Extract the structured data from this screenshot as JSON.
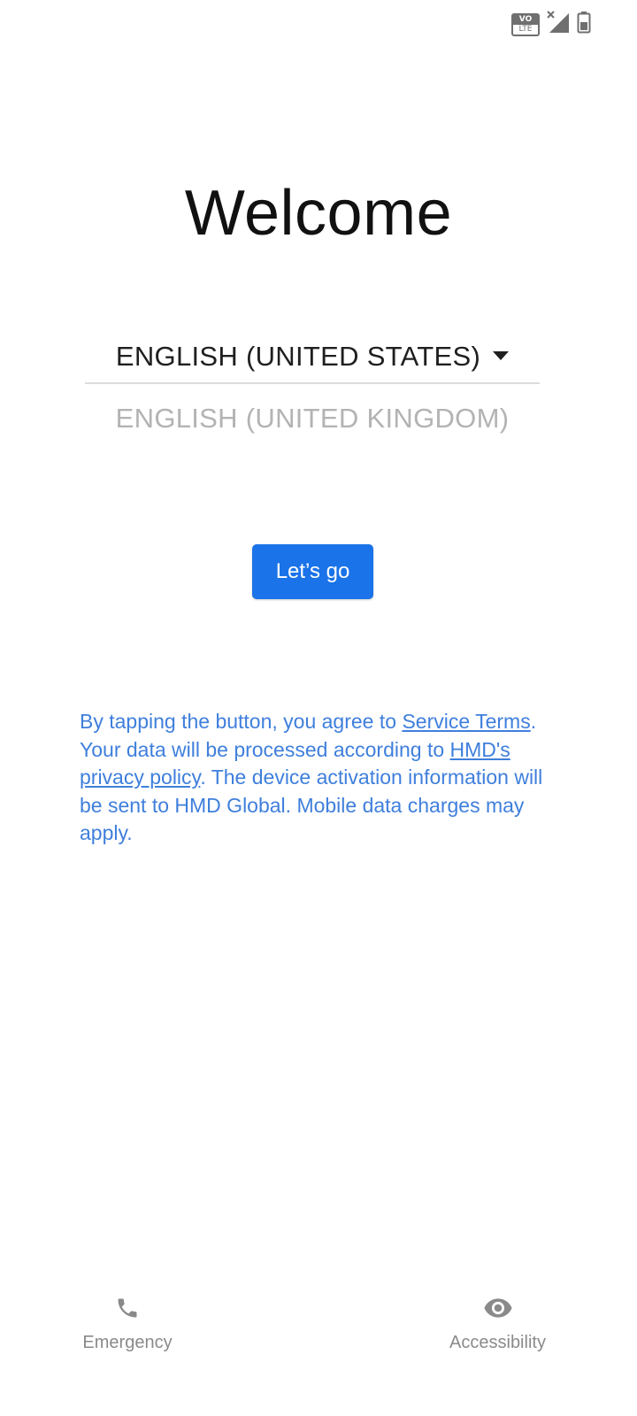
{
  "status_bar": {
    "volte_top": "VO",
    "volte_bottom": "LTE",
    "icons": [
      "volte-icon",
      "no-signal-icon",
      "battery-icon"
    ]
  },
  "welcome": {
    "title": "Welcome"
  },
  "language": {
    "selected": "ENGLISH (UNITED STATES)",
    "other": "ENGLISH (UNITED KINGDOM)"
  },
  "primary_button": {
    "label": "Let’s go"
  },
  "legal": {
    "part1": "By tapping the button, you agree to ",
    "service_terms_link": "Service Terms",
    "part2": ". Your data will be processed according to ",
    "privacy_link": "HMD's privacy policy",
    "part3": ". The device activation information will be sent to HMD Global. Mobile data charges may apply."
  },
  "bottom": {
    "emergency_label": "Emergency",
    "accessibility_label": "Accessibility"
  },
  "colors": {
    "accent": "#1a73e8",
    "legal_text": "#3f7fdc",
    "muted": "#8a8a8a"
  }
}
